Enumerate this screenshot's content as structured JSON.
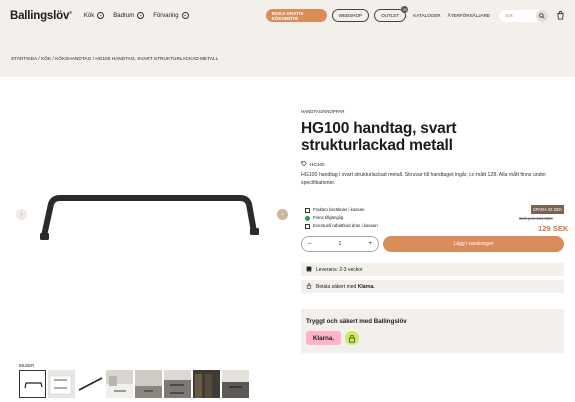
{
  "header": {
    "logo": "Ballingslöv",
    "nav": [
      "Kök",
      "Badrum",
      "Förvaring"
    ],
    "cta": "BOKA GRATIS KÖKSMÖTE",
    "webshop": "WEBSHOP",
    "outlet": "OUTLET",
    "outlet_badge": "45",
    "catalogs": "KATALOGER",
    "dealers": "ÅTERFÖRSÄLJARE",
    "search_placeholder": "Sök"
  },
  "breadcrumb": "STARTSIDA / KÖK / KÖKSHANDTAG / HG100 HANDTAG, SVART STRUKTURLACKAD METALL",
  "product": {
    "category": "HANDTAG/KNOPPAR",
    "title": "HG100 handtag, svart strukturlackad metall",
    "tag": "HG100",
    "description": "HG100 handtag i svart strukturlackad metall. Skruvar till handtaget ingår, cc-mått 128. Alla mått finns under specifikationer.",
    "features": [
      "Frakten beräknas i kassan",
      "Finns tillgänglig",
      "Eventuell rabattkod dras i kassan"
    ],
    "save_badge": "SPARA 32 SEK",
    "old_price": "Ord. pris 161 SEK",
    "price": "129 SEK",
    "quantity": "1",
    "add_to_cart": "Lägg i varukorgen",
    "delivery": "Leverans: 2-3 veckor",
    "pay_prefix": "Betala säkert med",
    "pay_brand": "Klarna."
  },
  "safe": {
    "title": "Tryggt och säkert med Ballingslöv",
    "klarna": "Klarna."
  },
  "gallery": {
    "label": "BILDER"
  }
}
